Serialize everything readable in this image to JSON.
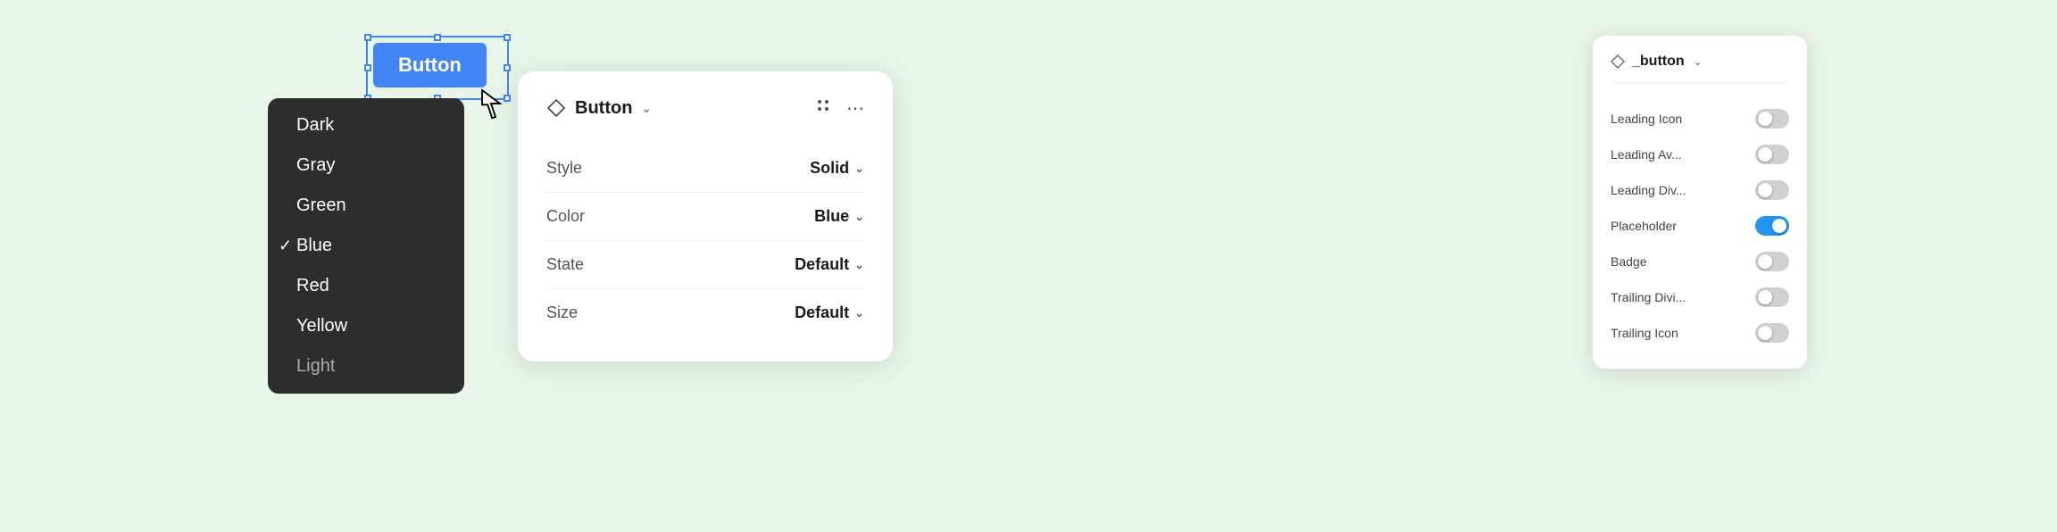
{
  "preview": {
    "button_label": "Button"
  },
  "dropdown": {
    "items": [
      {
        "id": "dark",
        "label": "Dark",
        "checked": false
      },
      {
        "id": "gray",
        "label": "Gray",
        "checked": false
      },
      {
        "id": "green",
        "label": "Green",
        "checked": false
      },
      {
        "id": "blue",
        "label": "Blue",
        "checked": true
      },
      {
        "id": "red",
        "label": "Red",
        "checked": false
      },
      {
        "id": "yellow",
        "label": "Yellow",
        "checked": false
      },
      {
        "id": "light",
        "label": "Light",
        "checked": false
      }
    ]
  },
  "button_panel": {
    "title": "Button",
    "rows": [
      {
        "label": "Style",
        "value": "Solid"
      },
      {
        "label": "Color",
        "value": "Blue"
      },
      {
        "label": "State",
        "value": "Default"
      },
      {
        "label": "Size",
        "value": "Default"
      }
    ]
  },
  "properties_panel": {
    "title": "_button",
    "props": [
      {
        "id": "leading-icon",
        "label": "Leading Icon",
        "on": false
      },
      {
        "id": "leading-av",
        "label": "Leading Av...",
        "on": false
      },
      {
        "id": "leading-div",
        "label": "Leading Div...",
        "on": false
      },
      {
        "id": "placeholder",
        "label": "Placeholder",
        "on": true
      },
      {
        "id": "badge",
        "label": "Badge",
        "on": false
      },
      {
        "id": "trailing-divi",
        "label": "Trailing Divi...",
        "on": false
      },
      {
        "id": "trailing-icon",
        "label": "Trailing Icon",
        "on": false
      }
    ]
  }
}
